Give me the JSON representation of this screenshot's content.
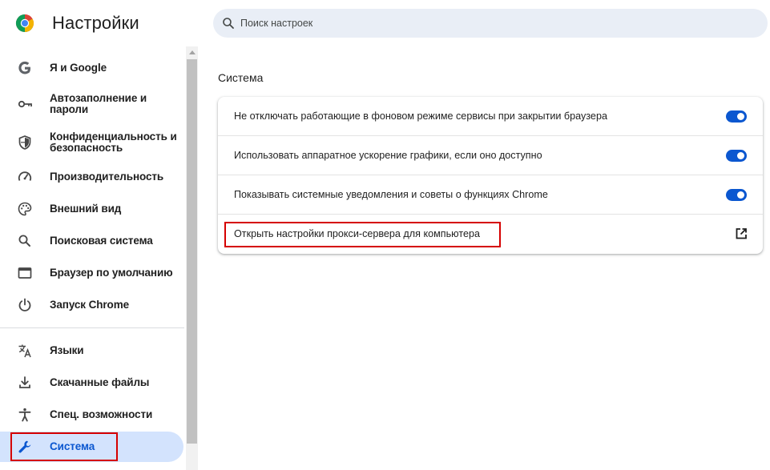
{
  "header": {
    "app_title": "Настройки",
    "search_placeholder": "Поиск настроек"
  },
  "sidebar": {
    "items": [
      {
        "label": "Я и Google",
        "icon": "google-g-icon"
      },
      {
        "label": "Автозаполнение и пароли",
        "icon": "key-icon"
      },
      {
        "label": "Конфиденциальность и безопасность",
        "icon": "shield-icon"
      },
      {
        "label": "Производительность",
        "icon": "speedometer-icon"
      },
      {
        "label": "Внешний вид",
        "icon": "palette-icon"
      },
      {
        "label": "Поисковая система",
        "icon": "search-icon"
      },
      {
        "label": "Браузер по умолчанию",
        "icon": "browser-window-icon"
      },
      {
        "label": "Запуск Chrome",
        "icon": "power-icon"
      },
      {
        "label": "Языки",
        "icon": "translate-icon"
      },
      {
        "label": "Скачанные файлы",
        "icon": "download-icon"
      },
      {
        "label": "Спец. возможности",
        "icon": "accessibility-icon"
      },
      {
        "label": "Система",
        "icon": "wrench-icon",
        "active": true
      }
    ]
  },
  "main": {
    "section_title": "Система",
    "rows": [
      {
        "label": "Не отключать работающие в фоновом режиме сервисы при закрытии браузера",
        "control": "toggle",
        "checked": true
      },
      {
        "label": "Использовать аппаратное ускорение графики, если оно доступно",
        "control": "toggle",
        "checked": true
      },
      {
        "label": "Показывать системные уведомления и советы о функциях Chrome",
        "control": "toggle",
        "checked": true
      },
      {
        "label": "Открыть настройки прокси-сервера для компьютера",
        "control": "external-link-icon"
      }
    ]
  },
  "colors": {
    "accent": "#0b57d0",
    "active_nav_bg": "#d3e3fd",
    "search_bg": "#e9eef6",
    "highlight_box": "#d50000"
  }
}
